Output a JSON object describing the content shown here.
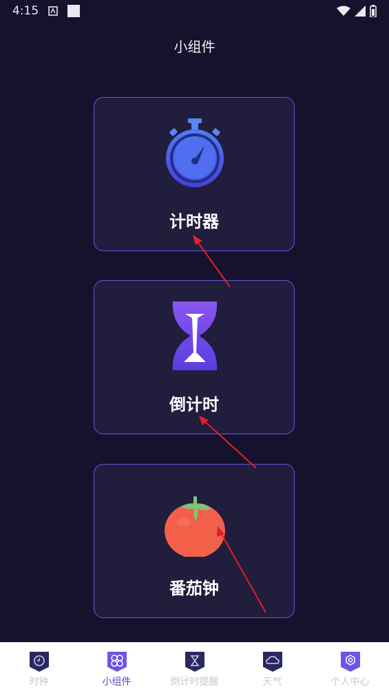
{
  "status_bar": {
    "time": "4:15"
  },
  "page_title": "小组件",
  "cards": [
    {
      "label": "计时器",
      "icon": "stopwatch-icon"
    },
    {
      "label": "倒计时",
      "icon": "hourglass-icon"
    },
    {
      "label": "番茄钟",
      "icon": "tomato-icon"
    }
  ],
  "bottom_nav": [
    {
      "label": "时钟",
      "icon": "clock-icon",
      "active": false
    },
    {
      "label": "小组件",
      "icon": "widgets-icon",
      "active": true
    },
    {
      "label": "倒计时提醒",
      "icon": "hourglass-icon",
      "active": false
    },
    {
      "label": "天气",
      "icon": "cloud-icon",
      "active": false
    },
    {
      "label": "个人中心",
      "icon": "gear-icon",
      "active": false
    }
  ],
  "colors": {
    "background": "#15122e",
    "card_border": "#6a5ae0",
    "accent": "#5b49c4",
    "arrow": "#e0202a"
  }
}
